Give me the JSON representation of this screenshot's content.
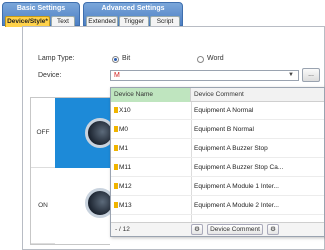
{
  "tab_groups": [
    {
      "title": "Basic Settings",
      "subtabs": [
        "Device/Style*",
        "Text"
      ]
    },
    {
      "title": "Advanced Settings",
      "subtabs": [
        "Extended",
        "Trigger",
        "Script"
      ]
    }
  ],
  "form": {
    "lamp_type_label": "Lamp Type:",
    "lamp_type_options": [
      "Bit",
      "Word"
    ],
    "lamp_type_selected": "Bit",
    "device_label": "Device:",
    "device_value": "M",
    "browse_label": "..."
  },
  "states": [
    {
      "label": "OFF"
    },
    {
      "label": "ON"
    }
  ],
  "device_list": {
    "headers": [
      "Device Name",
      "Device Comment"
    ],
    "rows": [
      {
        "name": "X10",
        "comment": "Equipment A Normal"
      },
      {
        "name": "M0",
        "comment": "Equipment B Normal"
      },
      {
        "name": "M1",
        "comment": "Equipment A Buzzer Stop"
      },
      {
        "name": "M11",
        "comment": "Equipment A Buzzer Stop Ca..."
      },
      {
        "name": "M12",
        "comment": "Equipment A Module 1 Inter..."
      },
      {
        "name": "M13",
        "comment": "Equipment A Module 2 Inter..."
      }
    ],
    "count": "- / 12",
    "comment_button": "Device Comment"
  },
  "colors": {
    "active_tab": "#ffd24a",
    "header_green": "#bfe5bf",
    "lamp_background": "#1d8ad8"
  }
}
